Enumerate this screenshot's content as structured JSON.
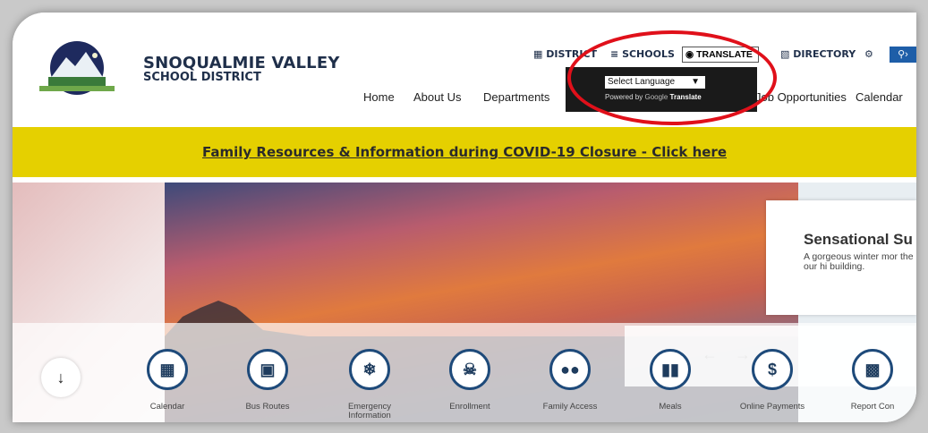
{
  "header": {
    "district_line1": "SNOQUALMIE VALLEY",
    "district_line2": "SCHOOL DISTRICT"
  },
  "utility": {
    "district": "DISTRICT",
    "schools": "SCHOOLS",
    "translate": "TRANSLATE",
    "directory": "DIRECTORY",
    "search_icon": "search-icon",
    "gear_icon": "gear-icon"
  },
  "nav": {
    "home": "Home",
    "about": "About Us",
    "departments": "Departments",
    "jobs": "Job Opportunities",
    "calendar": "Calendar"
  },
  "translate_dropdown": {
    "select_label": "Select Language",
    "powered_by": "Powered by",
    "google": "Google",
    "translate_word": "Translate"
  },
  "banner": {
    "text": "Family Resources & Information during COVID-19 Closure - Click here"
  },
  "hero": {
    "caption_title": "Sensational Su",
    "caption_body": "A gorgeous winter mor the bell tower of our hi building."
  },
  "quick_links": [
    {
      "label": "Calendar",
      "icon": "calendar-icon"
    },
    {
      "label": "Bus Routes",
      "icon": "bus-icon"
    },
    {
      "label": "Emergency Information",
      "icon": "snowflake-icon"
    },
    {
      "label": "Enrollment",
      "icon": "person-icon"
    },
    {
      "label": "Family Access",
      "icon": "people-icon"
    },
    {
      "label": "Meals",
      "icon": "utensils-icon"
    },
    {
      "label": "Online Payments",
      "icon": "dollar-icon"
    },
    {
      "label": "Report Con",
      "icon": "message-icon"
    }
  ],
  "colors": {
    "banner": "#e5d000",
    "nav_blue": "#1f2f4a",
    "highlight": "#e0101a"
  }
}
